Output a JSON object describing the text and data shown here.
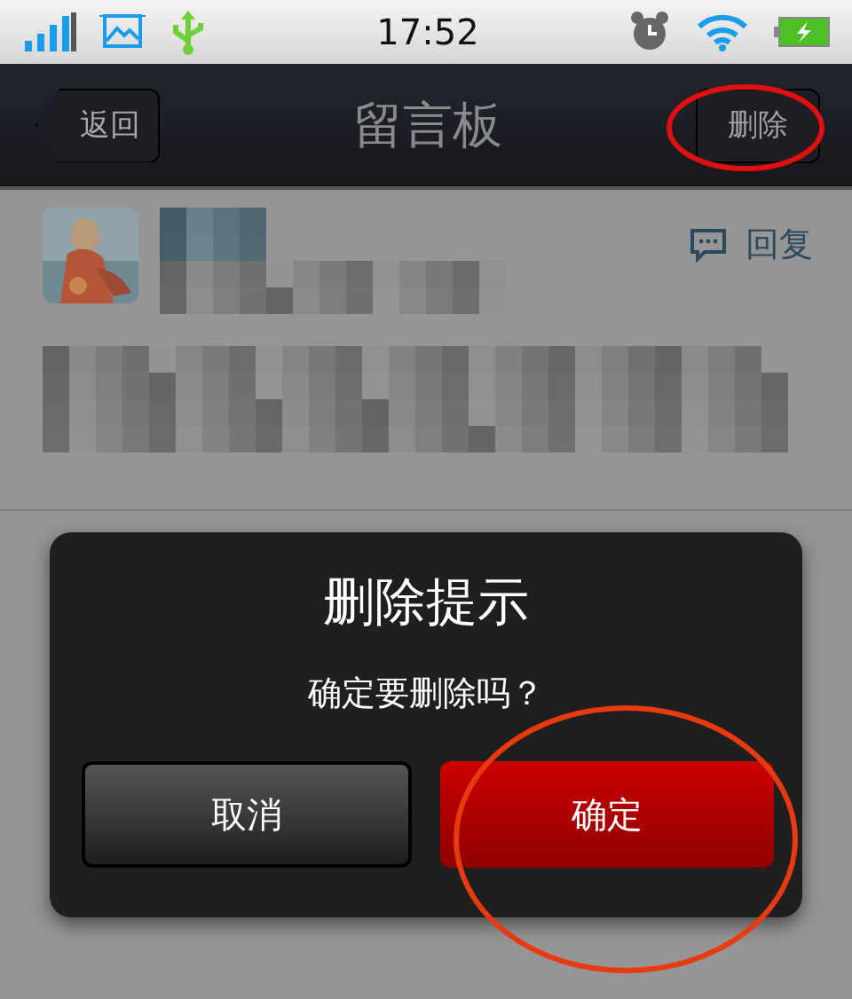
{
  "status_bar": {
    "time": "17:52"
  },
  "nav_bar": {
    "back": "返回",
    "title": "留言板",
    "action": "删除"
  },
  "message": {
    "reply": "回复"
  },
  "dialog": {
    "title": "删除提示",
    "message": "确定要删除吗？",
    "buttons": [
      {
        "label": "取消",
        "kind": "cancel"
      },
      {
        "label": "确定",
        "kind": "confirm"
      }
    ]
  },
  "annotations": [
    {
      "kind": "ellipse",
      "color": "#e01010"
    },
    {
      "kind": "ellipse",
      "color": "#e83a10"
    }
  ]
}
